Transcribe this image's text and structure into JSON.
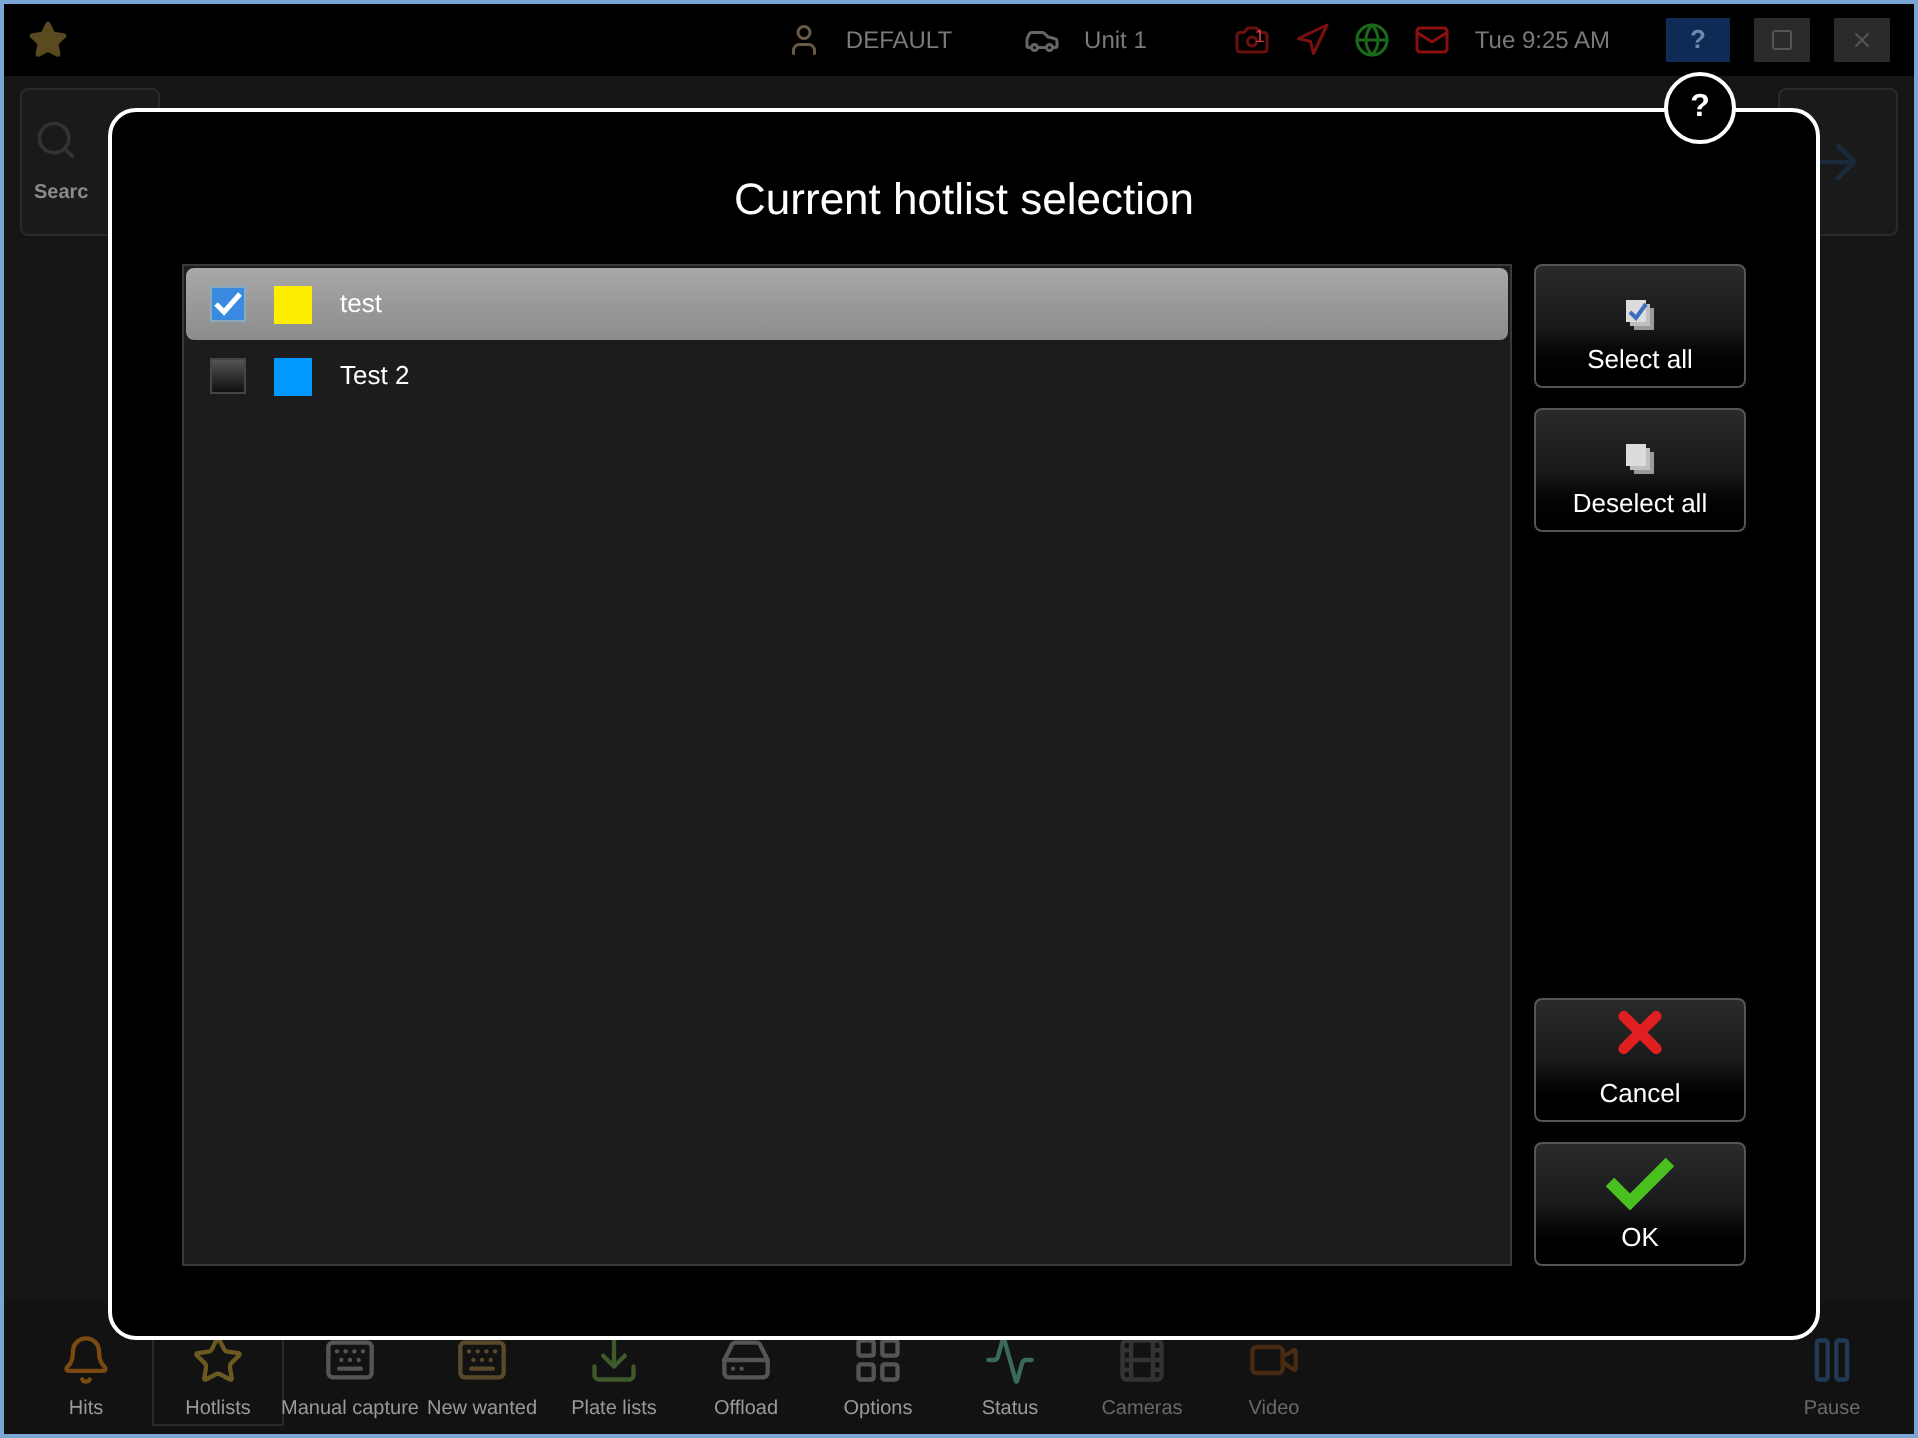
{
  "top_bar": {
    "user": "DEFAULT",
    "unit": "Unit 1",
    "alert_count": "1",
    "time": "Tue 9:25 AM",
    "help_label": "?"
  },
  "background": {
    "search_label": "Searc"
  },
  "toolbar": [
    {
      "label": "Hits",
      "kind": "bell",
      "selected": false,
      "disabled": false
    },
    {
      "label": "Hotlists",
      "kind": "star",
      "selected": true,
      "disabled": false
    },
    {
      "label": "Manual capture",
      "kind": "keyboard",
      "selected": false,
      "disabled": false
    },
    {
      "label": "New wanted",
      "kind": "wanted",
      "selected": false,
      "disabled": false
    },
    {
      "label": "Plate lists",
      "kind": "download",
      "selected": false,
      "disabled": false
    },
    {
      "label": "Offload",
      "kind": "offload",
      "selected": false,
      "disabled": false
    },
    {
      "label": "Options",
      "kind": "options",
      "selected": false,
      "disabled": false
    },
    {
      "label": "Status",
      "kind": "status",
      "selected": false,
      "disabled": false
    },
    {
      "label": "Cameras",
      "kind": "cameras",
      "selected": false,
      "disabled": true
    },
    {
      "label": "Video",
      "kind": "video",
      "selected": false,
      "disabled": true
    },
    {
      "label": "Pause",
      "kind": "pause",
      "selected": false,
      "disabled": true
    }
  ],
  "dialog": {
    "title": "Current hotlist selection",
    "help_label": "?",
    "hotlists": [
      {
        "name": "test",
        "checked": true,
        "selected": true,
        "color": "#ffee00"
      },
      {
        "name": "Test 2",
        "checked": false,
        "selected": false,
        "color": "#0099ff"
      }
    ],
    "buttons": [
      {
        "label": "Select all",
        "kind": "select"
      },
      {
        "label": "Deselect all",
        "kind": "deselect"
      },
      {
        "label": "Cancel",
        "kind": "cancel"
      },
      {
        "label": "OK",
        "kind": "ok"
      }
    ]
  }
}
